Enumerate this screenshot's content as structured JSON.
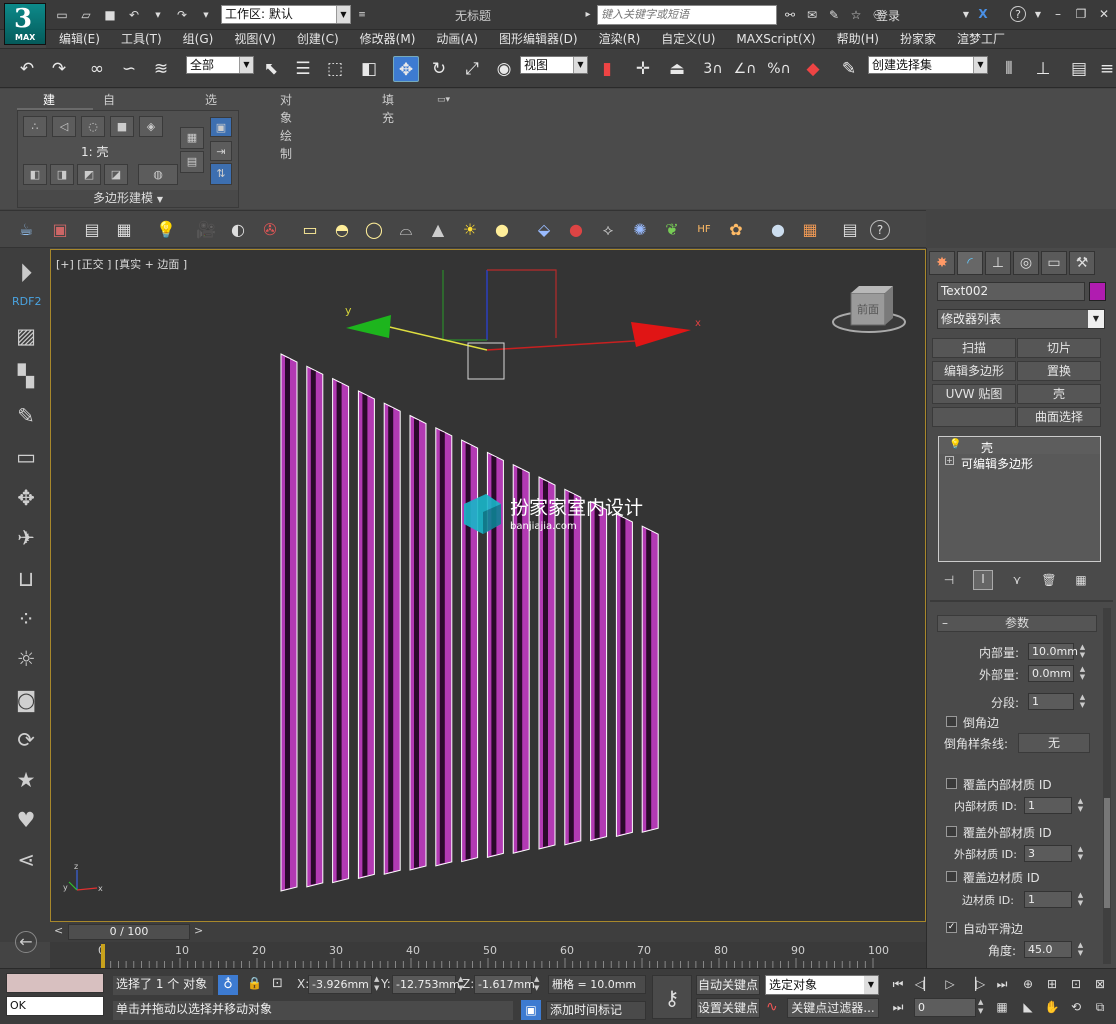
{
  "app": {
    "logo_text": "3",
    "logo_sub": "MAX",
    "window_title": "无标题"
  },
  "titlebar": {
    "workspace": "工作区: 默认",
    "search_placeholder": "键入关键字或短语",
    "login": "登录"
  },
  "menu": [
    "编辑(E)",
    "工具(T)",
    "组(G)",
    "视图(V)",
    "创建(C)",
    "修改器(M)",
    "动画(A)",
    "图形编辑器(D)",
    "渲染(R)",
    "自定义(U)",
    "MAXScript(X)",
    "帮助(H)",
    "扮家家",
    "渲梦工厂"
  ],
  "toolbar": {
    "selection_filter": "全部",
    "ref_coord": "视图",
    "named_selection": "创建选择集",
    "snap_labels": {
      "s3": "3",
      "angle": "∠",
      "percent": "%"
    }
  },
  "ribbon": {
    "tabs": [
      "建模",
      "自由形式",
      "选择",
      "对象绘制",
      "填充"
    ],
    "active_tab": "建模",
    "panel_caption": "1: 壳",
    "group_label": "多边形建模"
  },
  "left_dock": {
    "rdf_label": "RDF2"
  },
  "viewport": {
    "label": "[+] [正交 ] [真实 + 边面 ]",
    "axis_labels": {
      "x": "x",
      "y": "y"
    },
    "viewcube_face": "前面",
    "watermark_main": "扮家家室内设计",
    "watermark_sub": "banjiajia.com",
    "colors": {
      "bars": "#b23ab3",
      "edges": "#ffffff",
      "frame": "#a8882b"
    }
  },
  "command_panel": {
    "object_name": "Text002",
    "object_color": "#b01cb0",
    "modifier_list": "修改器列表",
    "mod_buttons": [
      [
        "扫描",
        "切片"
      ],
      [
        "编辑多边形",
        "置换"
      ],
      [
        "UVW 贴图",
        "壳"
      ],
      [
        "",
        "曲面选择"
      ]
    ],
    "stack": [
      {
        "label": "壳",
        "selected": true
      },
      {
        "label": "可编辑多边形",
        "selected": false
      }
    ],
    "rollout_title": "参数",
    "params": {
      "inner_label": "内部量:",
      "inner_value": "10.0mm",
      "outer_label": "外部量:",
      "outer_value": "0.0mm",
      "segments_label": "分段:",
      "segments_value": "1",
      "bevel_edges_label": "倒角边",
      "bevel_spline_label": "倒角样条线:",
      "bevel_spline_value": "无",
      "override_inner_label": "覆盖内部材质 ID",
      "inner_mat_label": "内部材质 ID:",
      "inner_mat_value": "1",
      "override_outer_label": "覆盖外部材质 ID",
      "outer_mat_label": "外部材质 ID:",
      "outer_mat_value": "3",
      "override_edge_label": "覆盖边材质 ID",
      "edge_mat_label": "边材质 ID:",
      "edge_mat_value": "1",
      "auto_smooth_label": "自动平滑边",
      "angle_label": "角度:",
      "angle_value": "45.0"
    }
  },
  "timeline": {
    "frame_display": "0 / 100",
    "ticks": [
      "0",
      "10",
      "20",
      "30",
      "40",
      "50",
      "60",
      "70",
      "80",
      "90",
      "100"
    ]
  },
  "status": {
    "maxscript_value": "OK",
    "selection_text": "选择了 1 个 对象",
    "prompt_text": "单击并拖动以选择并移动对象",
    "x_label": "X:",
    "x_value": "-3.926mm",
    "y_label": "Y:",
    "y_value": "-12.753mm",
    "z_label": "Z:",
    "z_value": "-1.617mm",
    "grid_text": "栅格 = 10.0mm",
    "add_time_tag": "添加时间标记",
    "auto_key": "自动关键点",
    "set_key": "设置关键点",
    "key_selection": "选定对象",
    "key_filters": "关键点过滤器...",
    "current_frame": "0"
  }
}
